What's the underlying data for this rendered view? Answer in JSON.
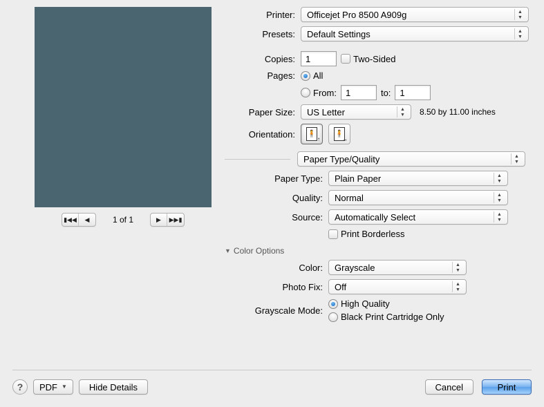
{
  "printer_label": "Printer:",
  "printer_value": "Officejet Pro 8500 A909g",
  "presets_label": "Presets:",
  "presets_value": "Default Settings",
  "copies_label": "Copies:",
  "copies_value": "1",
  "two_sided_label": "Two-Sided",
  "pages_label": "Pages:",
  "pages_all": "All",
  "pages_from": "From:",
  "pages_from_value": "1",
  "pages_to": "to:",
  "pages_to_value": "1",
  "paper_size_label": "Paper Size:",
  "paper_size_value": "US Letter",
  "paper_size_hint": "8.50 by 11.00 inches",
  "orientation_label": "Orientation:",
  "section_value": "Paper Type/Quality",
  "paper_type_label": "Paper Type:",
  "paper_type_value": "Plain Paper",
  "quality_label": "Quality:",
  "quality_value": "Normal",
  "source_label": "Source:",
  "source_value": "Automatically Select",
  "borderless_label": "Print Borderless",
  "color_options_label": "Color Options",
  "color_label": "Color:",
  "color_value": "Grayscale",
  "photo_fix_label": "Photo Fix:",
  "photo_fix_value": "Off",
  "grayscale_mode_label": "Grayscale Mode:",
  "grayscale_high": "High Quality",
  "grayscale_black": "Black Print Cartridge Only",
  "pager_label": "1 of 1",
  "help_symbol": "?",
  "pdf_label": "PDF",
  "hide_details_label": "Hide Details",
  "cancel_label": "Cancel",
  "print_label": "Print"
}
